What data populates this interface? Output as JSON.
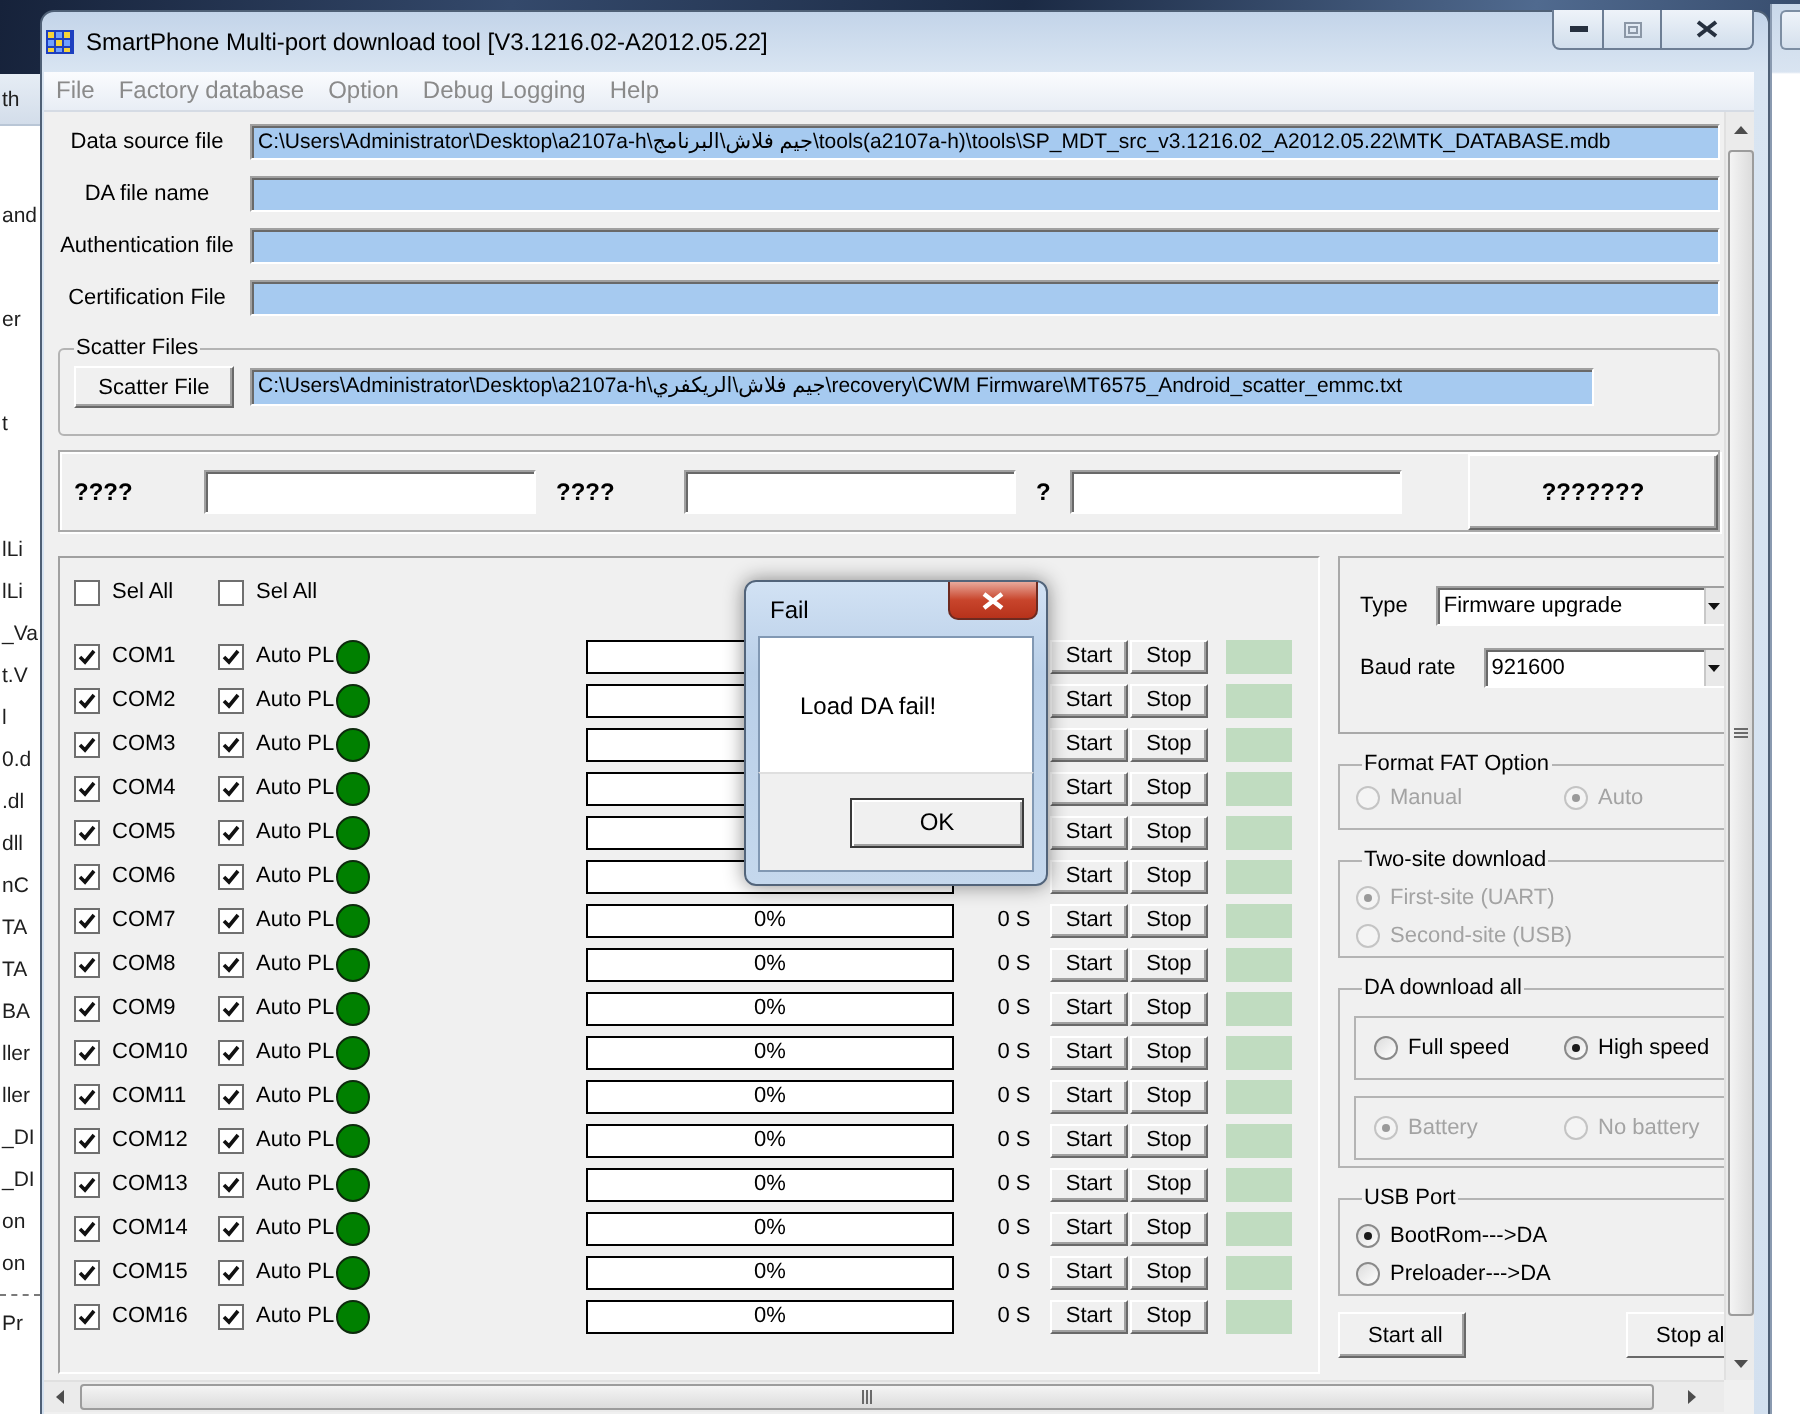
{
  "background_window": {
    "header": "th",
    "texts": [
      "and",
      "er",
      "t"
    ],
    "list": [
      "lLi",
      "lLi",
      "_Va",
      "t.V",
      "l",
      "0.d",
      ".dl",
      "dll",
      "nC",
      "TA",
      "TA",
      "BA",
      "ller",
      "ller",
      "_DI",
      "_DI",
      "on",
      "on"
    ],
    "last_item": "Pr"
  },
  "window": {
    "title": "SmartPhone Multi-port download tool [V3.1216.02-A2012.05.22]"
  },
  "menu": [
    {
      "label": "File",
      "disabled": true
    },
    {
      "label": "Factory database",
      "disabled": true
    },
    {
      "label": "Option",
      "disabled": true
    },
    {
      "label": "Debug Logging",
      "disabled": true
    },
    {
      "label": "Help",
      "disabled": true
    }
  ],
  "file_fields": [
    {
      "label": "Data source file",
      "value": "C:\\Users\\Administrator\\Desktop\\a2107a-h\\جيم فلاش\\البرنامج\\tools(a2107a-h)\\tools\\SP_MDT_src_v3.1216.02_A2012.05.22\\MTK_DATABASE.mdb"
    },
    {
      "label": "DA file name"
    },
    {
      "label": "Authentication file"
    },
    {
      "label": "Certification File"
    }
  ],
  "scatter_files": {
    "title": "Scatter Files",
    "button": "Scatter File",
    "value": "C:\\Users\\Administrator\\Desktop\\a2107a-h\\جيم فلاش\\الريكفري\\recovery\\CWM Firmware\\MT6575_Android_scatter_emmc.txt"
  },
  "id_row": {
    "fields": [
      {
        "label": "????"
      },
      {
        "label": "????"
      },
      {
        "label": "?"
      }
    ],
    "button": "???????"
  },
  "ports": {
    "select_all": [
      {
        "label": "Sel All",
        "checked": false
      },
      {
        "label": "Sel All",
        "checked": false
      }
    ],
    "rows": [
      {
        "port": "COM1",
        "checked": true,
        "auto": "Auto PL",
        "auto_checked": true,
        "color": "#008000",
        "level": 0,
        "start": "Start",
        "stop": "Stop"
      },
      {
        "port": "COM2",
        "checked": true,
        "auto": "Auto PL",
        "auto_checked": true,
        "color": "#008000",
        "level": 0,
        "start": "Start",
        "stop": "Stop"
      },
      {
        "port": "COM3",
        "checked": true,
        "auto": "Auto PL",
        "auto_checked": true,
        "color": "#008000",
        "level": 0,
        "start": "Start",
        "stop": "Stop"
      },
      {
        "port": "COM4",
        "checked": true,
        "auto": "Auto PL",
        "auto_checked": true,
        "color": "#008000",
        "level": 0,
        "start": "Start",
        "stop": "Stop"
      },
      {
        "port": "COM5",
        "checked": true,
        "auto": "Auto PL",
        "auto_checked": true,
        "color": "#008000",
        "level": 0,
        "start": "Start",
        "stop": "Stop"
      },
      {
        "port": "COM6",
        "checked": true,
        "auto": "Auto PL",
        "auto_checked": true,
        "color": "#008000",
        "level": 0,
        "start": "Start",
        "stop": "Stop"
      },
      {
        "port": "COM7",
        "checked": true,
        "auto": "Auto PL",
        "auto_checked": true,
        "color": "#008000",
        "level": 0,
        "progress": "0%",
        "time": "0 S",
        "start": "Start",
        "stop": "Stop"
      },
      {
        "port": "COM8",
        "checked": true,
        "auto": "Auto PL",
        "auto_checked": true,
        "color": "#008000",
        "level": 0,
        "progress": "0%",
        "time": "0 S",
        "start": "Start",
        "stop": "Stop"
      },
      {
        "port": "COM9",
        "checked": true,
        "auto": "Auto PL",
        "auto_checked": true,
        "color": "#008000",
        "level": 0,
        "progress": "0%",
        "time": "0 S",
        "start": "Start",
        "stop": "Stop"
      },
      {
        "port": "COM10",
        "checked": true,
        "auto": "Auto PL",
        "auto_checked": true,
        "color": "#008000",
        "level": 0,
        "progress": "0%",
        "time": "0 S",
        "start": "Start",
        "stop": "Stop"
      },
      {
        "port": "COM11",
        "checked": true,
        "auto": "Auto PL",
        "auto_checked": true,
        "color": "#008000",
        "level": 0,
        "progress": "0%",
        "time": "0 S",
        "start": "Start",
        "stop": "Stop"
      },
      {
        "port": "COM12",
        "checked": true,
        "auto": "Auto PL",
        "auto_checked": true,
        "color": "#008000",
        "level": 0,
        "progress": "0%",
        "time": "0 S",
        "start": "Start",
        "stop": "Stop"
      },
      {
        "port": "COM13",
        "checked": true,
        "auto": "Auto PL",
        "auto_checked": true,
        "color": "#008000",
        "level": 0,
        "progress": "0%",
        "time": "0 S",
        "start": "Start",
        "stop": "Stop"
      },
      {
        "port": "COM14",
        "checked": true,
        "auto": "Auto PL",
        "auto_checked": true,
        "color": "#008000",
        "level": 0,
        "progress": "0%",
        "time": "0 S",
        "start": "Start",
        "stop": "Stop"
      },
      {
        "port": "COM15",
        "checked": true,
        "auto": "Auto PL",
        "auto_checked": true,
        "color": "#008000",
        "level": 0,
        "progress": "0%",
        "time": "0 S",
        "start": "Start",
        "stop": "Stop"
      },
      {
        "port": "COM16",
        "checked": true,
        "auto": "Auto PL",
        "auto_checked": true,
        "color": "#008000",
        "level": 0,
        "progress": "0%",
        "time": "0 S",
        "start": "Start",
        "stop": "Stop"
      }
    ]
  },
  "type": {
    "label": "Type",
    "value": "Firmware upgrade"
  },
  "baud_rate": {
    "label": "Baud rate",
    "value": "921600"
  },
  "option_groups": [
    {
      "title": "Format FAT Option",
      "kind": "row",
      "options": [
        {
          "label": "Manual",
          "selected": false,
          "disabled": true
        },
        {
          "label": "Auto",
          "selected": true,
          "disabled": true
        }
      ]
    },
    {
      "title": "Two-site download",
      "kind": "column",
      "options": [
        {
          "label": "First-site (UART)",
          "selected": true,
          "disabled": true
        },
        {
          "label": "Second-site (USB)",
          "selected": false,
          "disabled": true
        }
      ]
    },
    {
      "title": "DA download all",
      "kind": "boxes",
      "boxes": [
        {
          "options": [
            {
              "label": "Full speed",
              "selected": false,
              "disabled": false
            },
            {
              "label": "High speed",
              "selected": true,
              "disabled": false
            }
          ]
        },
        {
          "options": [
            {
              "label": "Battery",
              "selected": true,
              "disabled": true
            },
            {
              "label": "No battery",
              "selected": false,
              "disabled": true
            }
          ]
        }
      ]
    },
    {
      "title": "USB Port",
      "kind": "column",
      "options": [
        {
          "label": "BootRom--->DA",
          "selected": true,
          "disabled": false
        },
        {
          "label": "Preloader--->DA",
          "selected": false,
          "disabled": false
        }
      ]
    }
  ],
  "actions": [
    "Start all",
    "Stop al"
  ],
  "dialog": {
    "title": "Fail",
    "message": "Load DA fail!",
    "button": "OK"
  }
}
